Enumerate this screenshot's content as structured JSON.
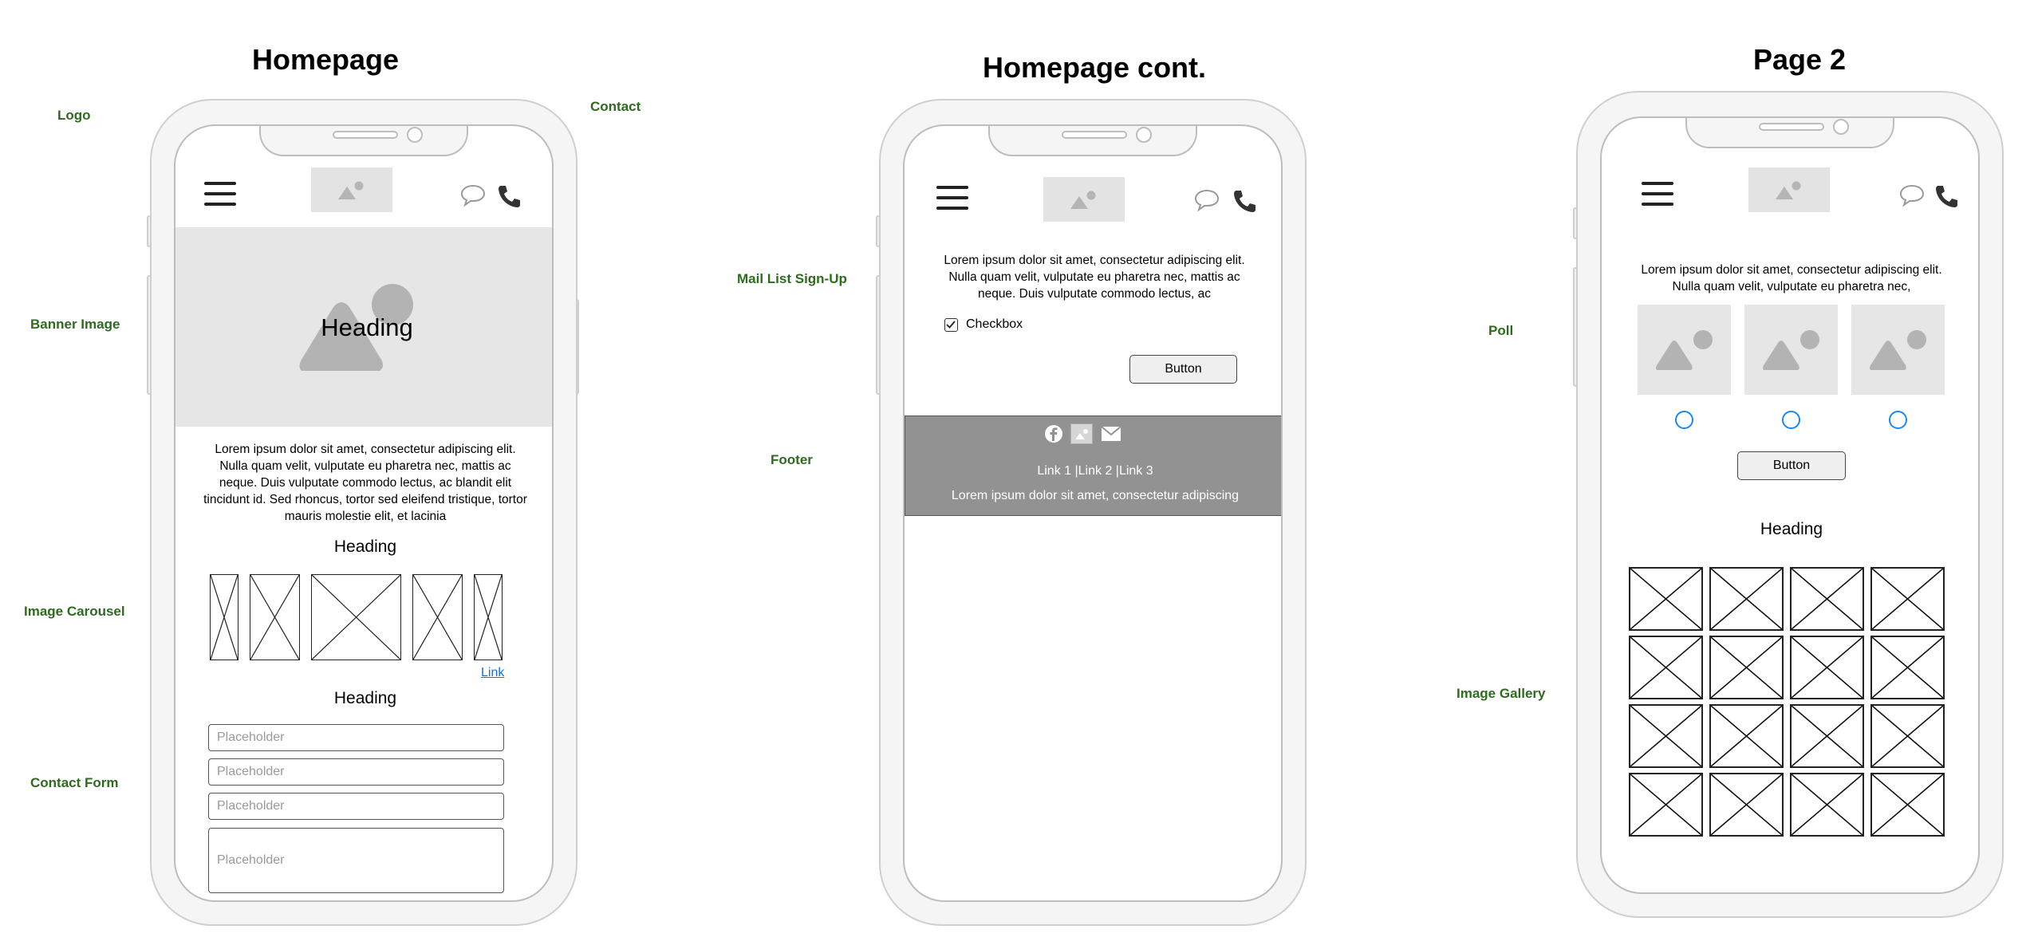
{
  "titles": {
    "homepage": "Homepage",
    "homepage_cont": "Homepage cont.",
    "page2": "Page 2"
  },
  "annotations": {
    "logo": "Logo",
    "contact": "Contact",
    "banner_image": "Banner Image",
    "image_carousel": "Image Carousel",
    "contact_form": "Contact Form",
    "mail_list": "Mail List Sign-Up",
    "footer": "Footer",
    "poll": "Poll",
    "image_gallery": "Image Gallery"
  },
  "homepage": {
    "banner_heading": "Heading",
    "lorem": "Lorem ipsum dolor sit amet, consectetur adipiscing elit. Nulla quam velit, vulputate eu pharetra nec, mattis ac neque. Duis vulputate commodo lectus, ac blandit elit tincidunt id. Sed rhoncus, tortor sed eleifend tristique, tortor mauris molestie elit, et lacinia",
    "carousel_heading": "Heading",
    "carousel_link": "Link",
    "form_heading": "Heading",
    "placeholders": [
      "Placeholder",
      "Placeholder",
      "Placeholder",
      "Placeholder"
    ]
  },
  "homepage_cont": {
    "lorem": "Lorem ipsum dolor sit amet, consectetur adipiscing elit. Nulla quam velit, vulputate eu pharetra nec, mattis ac neque. Duis vulputate commodo lectus, ac",
    "checkbox_label": "Checkbox",
    "button": "Button",
    "footer_links": "Link 1 |Link 2 |Link 3",
    "footer_text": "Lorem ipsum dolor sit amet, consectetur adipiscing"
  },
  "page2": {
    "lorem": "Lorem ipsum dolor sit amet, consectetur adipiscing elit. Nulla quam velit, vulputate eu pharetra nec,",
    "button": "Button",
    "heading": "Heading"
  },
  "icons": {
    "menu": "hamburger-menu-icon",
    "logo": "image-placeholder-icon",
    "chat": "chat-bubble-icon",
    "phone": "phone-icon",
    "facebook": "facebook-icon",
    "image": "image-icon",
    "mail": "mail-icon"
  },
  "colors": {
    "annotation": "#2e6b1e",
    "footer_bg": "#929292",
    "radio": "#1e88e5",
    "link": "#1a6fd1"
  }
}
